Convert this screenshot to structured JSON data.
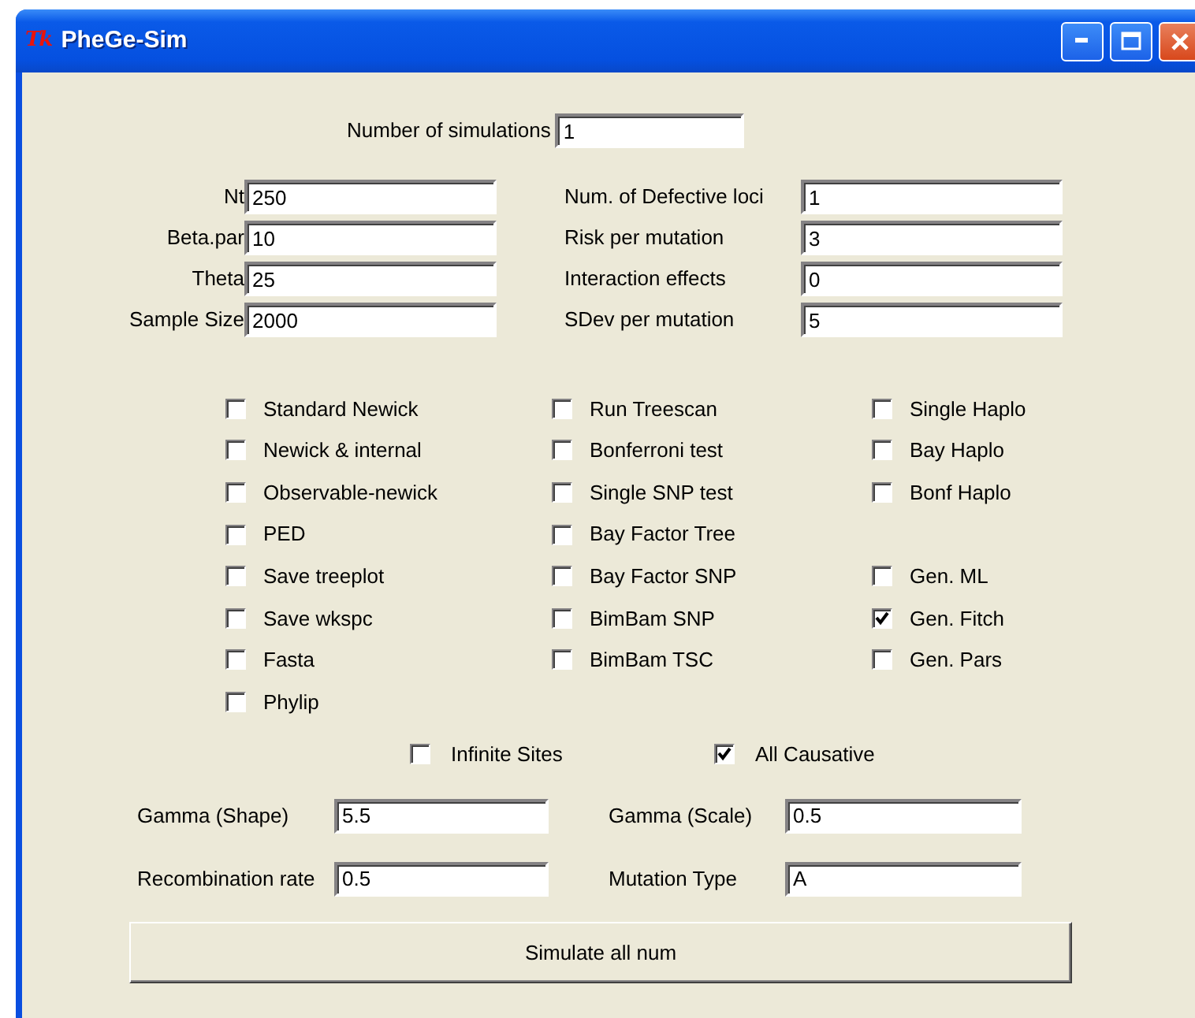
{
  "window": {
    "app_icon": "Tk",
    "title": "PheGe-Sim"
  },
  "simulations": {
    "label": "Number of simulations",
    "value": "1"
  },
  "params_left": [
    {
      "label": "Nt",
      "value": "250"
    },
    {
      "label": "Beta.par",
      "value": "10"
    },
    {
      "label": "Theta",
      "value": "25"
    },
    {
      "label": "Sample Size",
      "value": "2000"
    }
  ],
  "params_right": [
    {
      "label": "Num. of  Defective loci",
      "value": "1"
    },
    {
      "label": "Risk per mutation",
      "value": "3"
    },
    {
      "label": "Interaction effects",
      "value": "0"
    },
    {
      "label": "SDev per mutation",
      "value": "5"
    }
  ],
  "option_rows": [
    [
      {
        "label": "Standard Newick",
        "checked": false
      },
      {
        "label": "Run Treescan",
        "checked": false
      },
      {
        "label": "Single Haplo",
        "checked": false
      }
    ],
    [
      {
        "label": "Newick & internal",
        "checked": false
      },
      {
        "label": "Bonferroni test",
        "checked": false
      },
      {
        "label": "Bay Haplo",
        "checked": false
      }
    ],
    [
      {
        "label": "Observable-newick",
        "checked": false
      },
      {
        "label": "Single SNP test",
        "checked": false
      },
      {
        "label": "Bonf Haplo",
        "checked": false
      }
    ],
    [
      {
        "label": "PED",
        "checked": false
      },
      {
        "label": "Bay Factor Tree",
        "checked": false
      }
    ],
    [
      {
        "label": "Save treeplot",
        "checked": false
      },
      {
        "label": "Bay Factor SNP",
        "checked": false
      },
      {
        "label": "Gen. ML",
        "checked": false
      }
    ],
    [
      {
        "label": "Save wkspc",
        "checked": false
      },
      {
        "label": "BimBam SNP",
        "checked": false
      },
      {
        "label": "Gen. Fitch",
        "checked": true
      }
    ],
    [
      {
        "label": "Fasta",
        "checked": false
      },
      {
        "label": "BimBam TSC",
        "checked": false
      },
      {
        "label": "Gen. Pars",
        "checked": false
      }
    ],
    [
      {
        "label": "Phylip",
        "checked": false
      }
    ]
  ],
  "flags": [
    {
      "label": "Infinite Sites",
      "checked": false
    },
    {
      "label": "All Causative",
      "checked": true
    }
  ],
  "distribution_params": [
    [
      {
        "label": "Gamma (Shape)",
        "value": "5.5"
      },
      {
        "label": "Gamma (Scale)",
        "value": "0.5"
      }
    ],
    [
      {
        "label": "Recombination rate",
        "value": "0.5"
      },
      {
        "label": "Mutation Type",
        "value": "A"
      }
    ]
  ],
  "button": "Simulate all num"
}
